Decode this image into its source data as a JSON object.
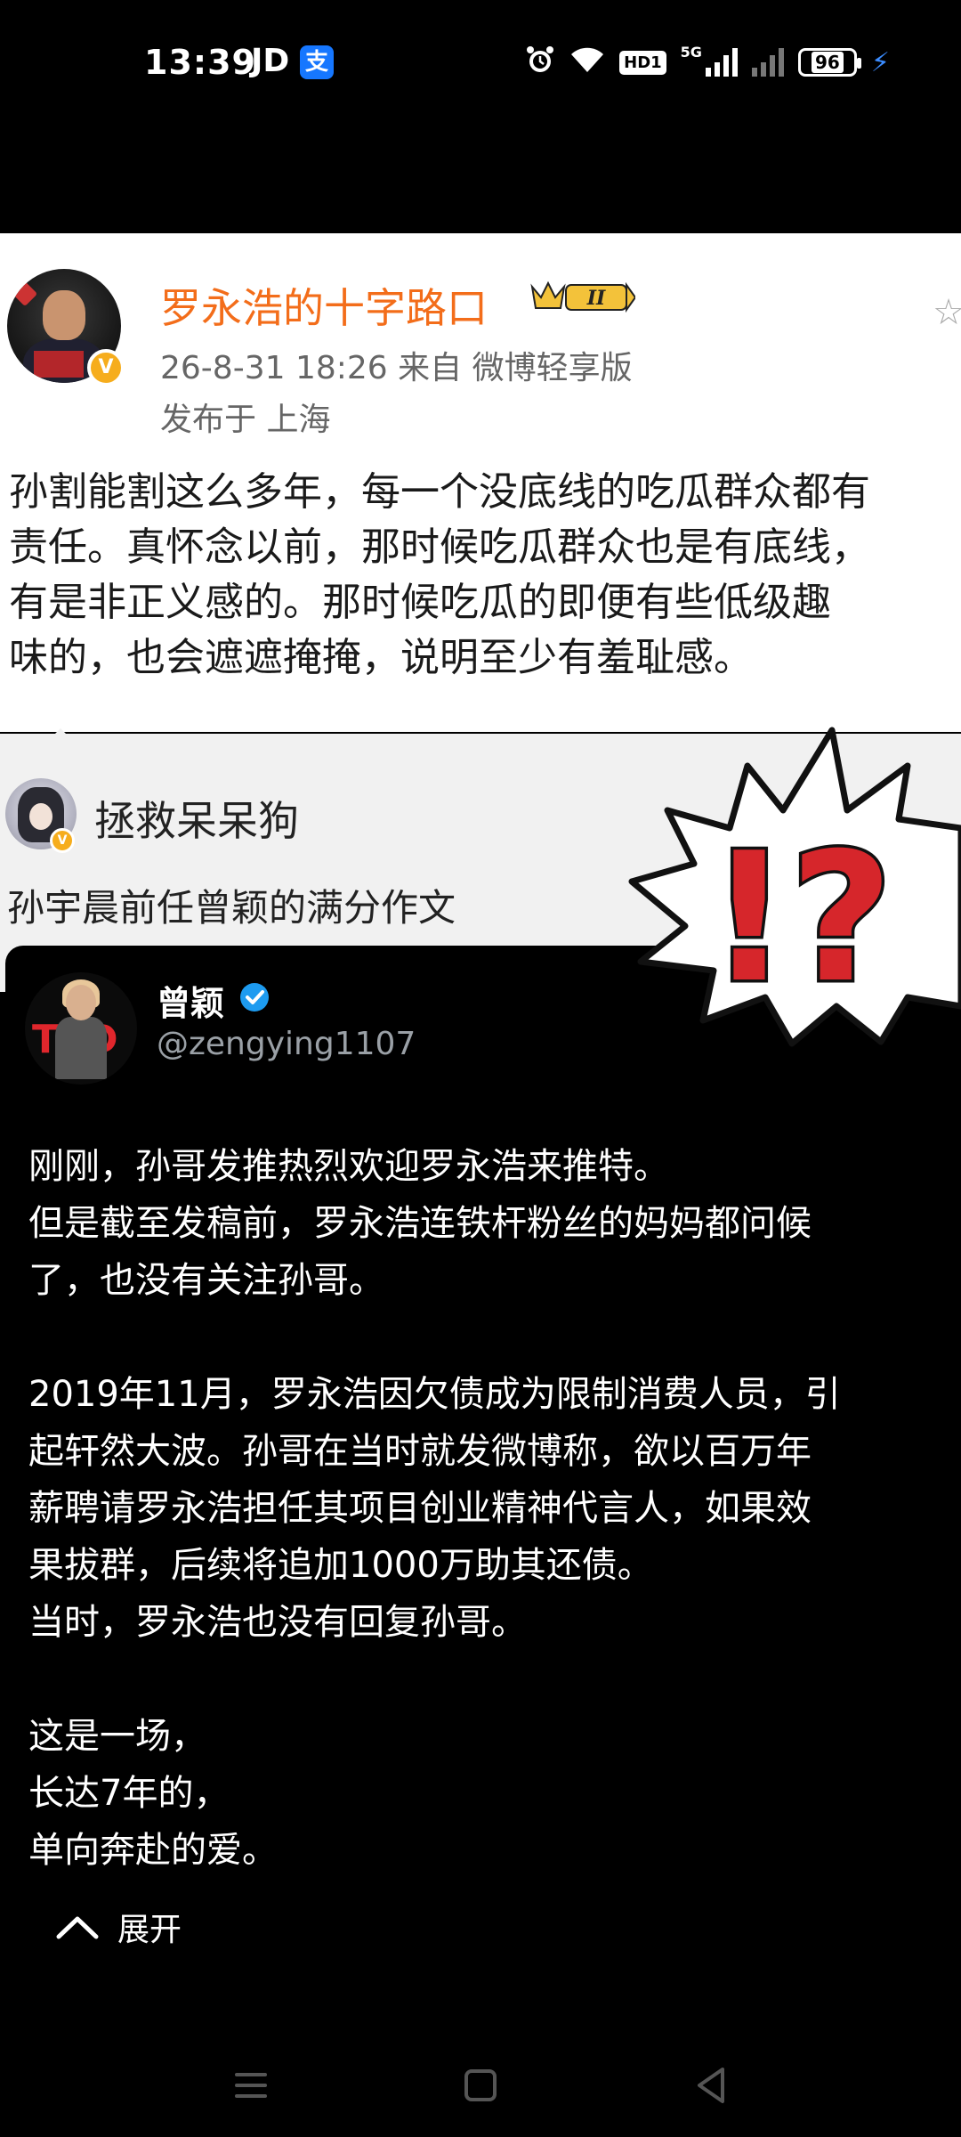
{
  "status_bar": {
    "time": "13:39",
    "carrier_app": "JD",
    "alipay_glyph": "支",
    "hd_label": "HD1",
    "network_label": "5G",
    "battery_level": "96",
    "icons": [
      "alarm-icon",
      "wifi-icon",
      "hd-icon",
      "signal-icon",
      "signal-x-icon",
      "battery-icon",
      "charging-icon"
    ]
  },
  "weibo_post": {
    "author_name": "罗永浩的十字路口",
    "member_level": "II",
    "timestamp_source": "26-8-31 18:26  来自 微博轻享版",
    "location": "发布于 上海",
    "body": "孙割能割这么多年，每一个没底线的吃瓜群众都有\n责任。真怀念以前，那时候吃瓜群众也是有底线，\n有是非正义感的￼。那时候吃瓜的即便有些低级趣\n味的，也会遮遮掩掩，说明至少有羞耻感。",
    "verified_glyph": "V"
  },
  "repost": {
    "user_name": "拯救呆呆狗",
    "text": "孙宇晨前任曾颖的满分作文"
  },
  "sticker": {
    "text": "!?",
    "colors": {
      "mark": "#d6262b",
      "outline": "#111111",
      "fill": "#ffffff"
    }
  },
  "tweet": {
    "name": "曾颖",
    "handle": "@zengying1107",
    "body": "刚刚，孙哥发推热烈欢迎罗永浩来推特。\n但是截至发稿前，罗永浩连铁杆粉丝的妈妈都问候\n了，也没有关注孙哥。\n\n2019年11月，罗永浩因欠债成为限制消费人员，引\n起轩然大波。孙哥在当时就发微博称，欲以百万年\n薪聘请罗永浩担任其项目创业精神代言人，如果效\n果拔群，后续将追加1000万助其还债。\n当时，罗永浩也没有回复孙哥。\n\n这是一场，\n长达7年的，\n单向奔赴的爱。"
  },
  "expand": {
    "label": "展开"
  },
  "colors": {
    "author_orange": "#f36d1a",
    "verified_yellow": "#f6ad1d",
    "twitter_blue": "#1d9bf0",
    "background": "#000000"
  }
}
